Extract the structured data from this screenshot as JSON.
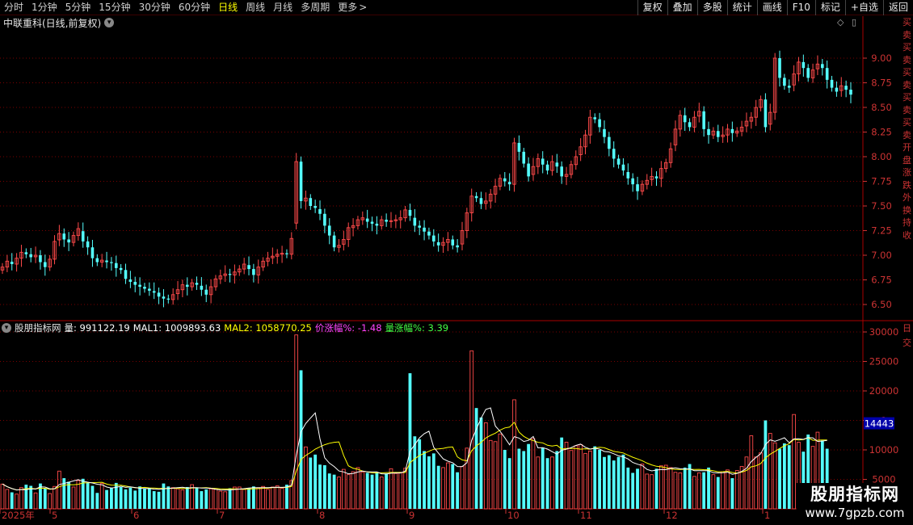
{
  "topbar": {
    "tabs": [
      "分时",
      "1分钟",
      "5分钟",
      "15分钟",
      "30分钟",
      "60分钟",
      "日线",
      "周线",
      "月线",
      "多周期",
      "更多"
    ],
    "active_tab": "日线",
    "more_icon": "chevron-right-icon",
    "tools": [
      "复权",
      "叠加",
      "多股",
      "统计",
      "画线",
      "F10",
      "标记",
      "+自选",
      "返回"
    ]
  },
  "stock": {
    "title": "中联重科(日线,前复权)",
    "settings_icon": "chevron-down-icon"
  },
  "corner_icons": [
    "◇",
    "▯"
  ],
  "indicator": {
    "name": "股朋指标网",
    "vol_label": "量: 991122.19",
    "mal1_label": "MAL1: 1009893.63",
    "mal2_label": "MAL2: 1058770.25",
    "price_chg_label": "价涨幅%: -1.48",
    "vol_chg_label": "量涨幅%: 3.39"
  },
  "watermark": {
    "big": "股朋指标网",
    "small": "www.7gpzb.com"
  },
  "right_strip_top": [
    "买",
    "卖",
    "买",
    "卖",
    "买",
    "卖",
    "买",
    "卖",
    "买",
    "卖",
    "开",
    "盘",
    "涨",
    "跌",
    "外",
    "换",
    "持",
    "收"
  ],
  "right_strip_bottom": [
    "日",
    "交"
  ],
  "colors": {
    "up": "#ff4a4a",
    "down": "#54ffff",
    "mal1": "#ffffff",
    "mal2": "#ffff00",
    "grid": "#7a0000",
    "axis": "#cc3333"
  },
  "chart_data": [
    {
      "type": "candlestick",
      "title": "中联重科(日线,前复权)",
      "y_ticks": [
        9.0,
        8.75,
        8.5,
        8.25,
        8.0,
        7.75,
        7.5,
        7.25,
        7.0,
        6.75,
        6.5
      ],
      "ylim": [
        6.4,
        9.25
      ],
      "x_labels": [
        "2025年",
        "5",
        "6",
        "7",
        "8",
        "9",
        "10",
        "11",
        "12",
        "1"
      ],
      "legend": "none",
      "close": [
        6.88,
        6.94,
        6.91,
        6.97,
        7.03,
        7.01,
        6.98,
        7.0,
        6.93,
        6.88,
        6.96,
        7.14,
        7.22,
        7.16,
        7.13,
        7.2,
        7.27,
        7.14,
        7.08,
        6.97,
        6.93,
        6.95,
        6.93,
        6.92,
        6.87,
        6.85,
        6.76,
        6.73,
        6.7,
        6.68,
        6.66,
        6.64,
        6.62,
        6.58,
        6.56,
        6.55,
        6.6,
        6.65,
        6.7,
        6.68,
        6.72,
        6.7,
        6.65,
        6.6,
        6.68,
        6.76,
        6.79,
        6.81,
        6.8,
        6.83,
        6.86,
        6.91,
        6.86,
        6.8,
        6.88,
        6.94,
        6.97,
        6.99,
        7.01,
        7.02,
        7.01,
        7.17,
        7.95,
        7.55,
        7.58,
        7.5,
        7.48,
        7.42,
        7.3,
        7.2,
        7.08,
        7.1,
        7.16,
        7.28,
        7.3,
        7.36,
        7.38,
        7.34,
        7.32,
        7.3,
        7.36,
        7.34,
        7.35,
        7.36,
        7.38,
        7.46,
        7.4,
        7.3,
        7.28,
        7.24,
        7.2,
        7.14,
        7.1,
        7.13,
        7.16,
        7.1,
        7.08,
        7.25,
        7.43,
        7.6,
        7.58,
        7.52,
        7.55,
        7.62,
        7.7,
        7.78,
        7.75,
        7.72,
        8.14,
        8.05,
        7.93,
        7.8,
        7.9,
        7.98,
        7.92,
        7.86,
        7.95,
        7.9,
        7.8,
        7.82,
        7.92,
        8.0,
        8.1,
        8.22,
        8.4,
        8.38,
        8.3,
        8.2,
        8.08,
        7.98,
        7.92,
        7.86,
        7.78,
        7.72,
        7.65,
        7.72,
        7.76,
        7.8,
        7.78,
        7.88,
        7.94,
        8.08,
        8.28,
        8.42,
        8.35,
        8.3,
        8.4,
        8.46,
        8.28,
        8.22,
        8.26,
        8.2,
        8.22,
        8.28,
        8.24,
        8.26,
        8.3,
        8.36,
        8.4,
        8.5,
        8.58,
        8.3,
        8.45,
        9.0,
        8.8,
        8.72,
        8.7,
        8.84,
        8.96,
        8.9,
        8.8,
        8.88,
        8.94,
        8.9,
        8.78,
        8.7,
        8.66,
        8.72,
        8.68,
        8.63
      ]
    },
    {
      "type": "bar",
      "title": "股朋指标网",
      "y_ticks": [
        30000,
        25000,
        20000,
        15000,
        10000,
        5000
      ],
      "y_tick_labels": [
        "30000",
        "25000",
        "20000",
        "1",
        "10000",
        "5000"
      ],
      "ylim": [
        0,
        32000
      ],
      "current_value_label": "14443",
      "series": [
        {
          "name": "量"
        },
        {
          "name": "MAL1"
        },
        {
          "name": "MAL2"
        }
      ],
      "values": [
        4200,
        3300,
        2800,
        2500,
        3600,
        4100,
        3900,
        2700,
        4300,
        3500,
        2600,
        3800,
        6400,
        5200,
        4600,
        3700,
        4800,
        5100,
        4400,
        3900,
        2700,
        4300,
        3200,
        3600,
        4400,
        3700,
        3300,
        3600,
        3100,
        3800,
        3400,
        3400,
        3000,
        2900,
        4300,
        3800,
        3600,
        3400,
        3200,
        3700,
        4100,
        3600,
        3000,
        3300,
        3400,
        3300,
        3000,
        2900,
        3500,
        3700,
        3700,
        3300,
        3500,
        3800,
        3600,
        3800,
        3300,
        3700,
        3900,
        3500,
        4100,
        4800,
        29500,
        23500,
        10500,
        8700,
        9200,
        7500,
        7400,
        6000,
        5800,
        5400,
        6700,
        5800,
        6300,
        7000,
        6200,
        6100,
        5800,
        6200,
        5400,
        6000,
        6800,
        6000,
        6200,
        6900,
        23000,
        12300,
        11800,
        9800,
        8900,
        9400,
        7300,
        7000,
        7800,
        7600,
        6200,
        7200,
        10300,
        26800,
        17100,
        15500,
        14600,
        11600,
        11400,
        12700,
        10000,
        8600,
        18500,
        10200,
        9800,
        11000,
        11900,
        8800,
        10400,
        8600,
        8800,
        9800,
        12100,
        11300,
        9900,
        10700,
        10900,
        9400,
        9800,
        10600,
        10000,
        8800,
        9100,
        8200,
        8800,
        9200,
        7000,
        6100,
        6800,
        7600,
        5900,
        5800,
        6800,
        7300,
        7400,
        7000,
        6200,
        6100,
        7000,
        7600,
        5500,
        6100,
        6200,
        7000,
        5800,
        5400,
        6300,
        6600,
        5200,
        6500,
        7200,
        8800,
        12400,
        8800,
        9500,
        15000,
        12800,
        11200,
        10200,
        11100,
        10800,
        16000,
        11300,
        9700,
        12600,
        10600,
        13000,
        11600,
        10200
      ]
    }
  ]
}
